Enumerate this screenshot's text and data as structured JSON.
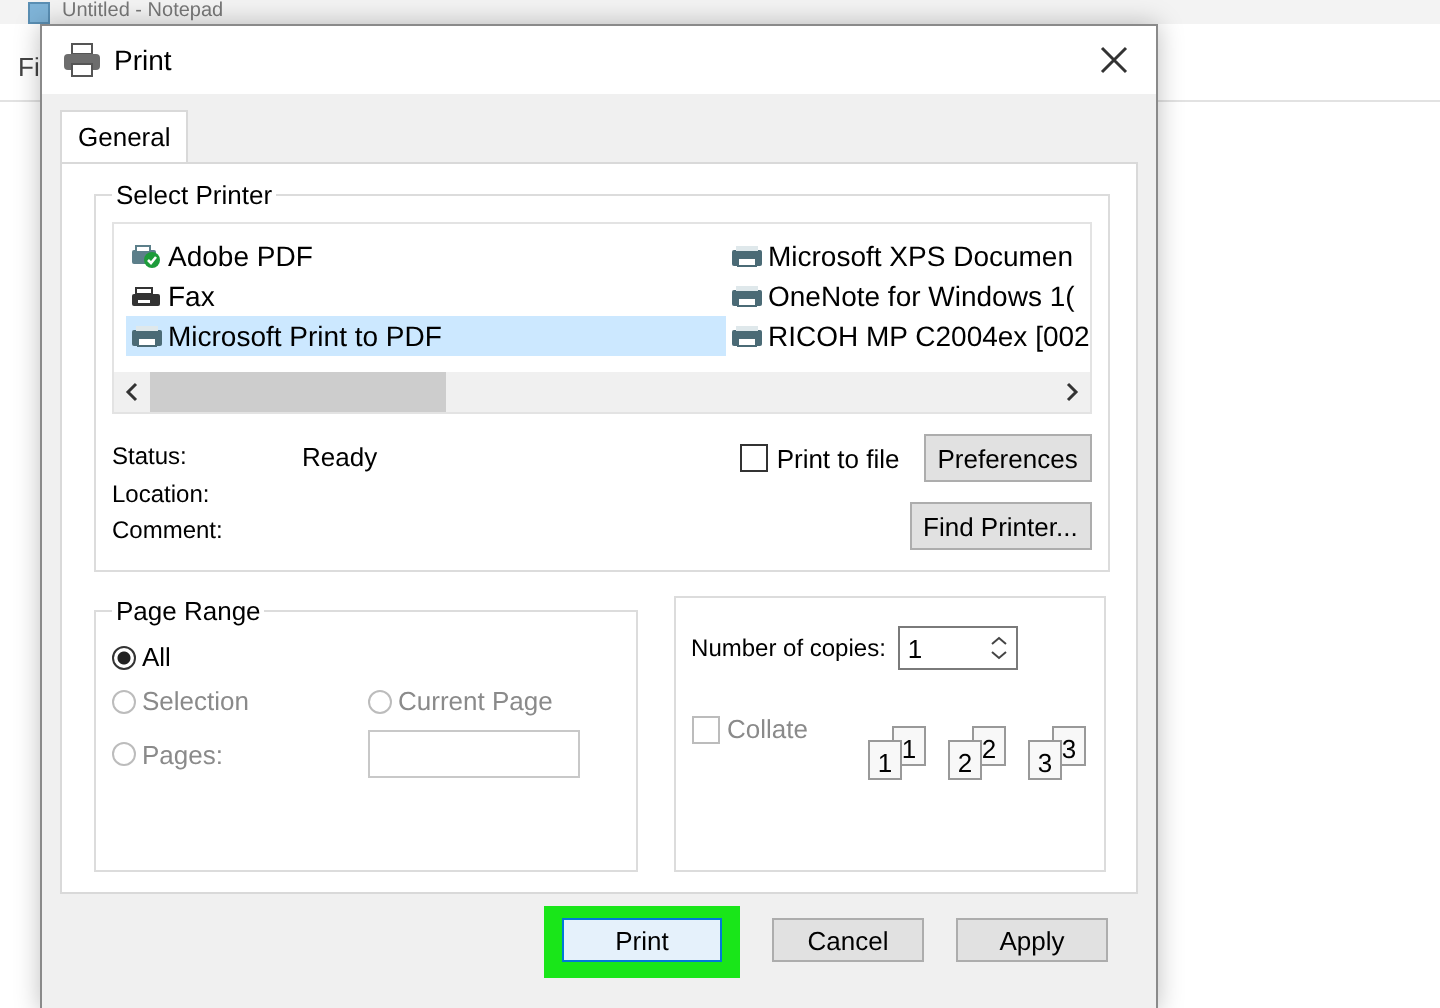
{
  "background_window": {
    "title": "Untitled - Notepad",
    "menu_item": "Fi"
  },
  "dialog": {
    "title": "Print"
  },
  "tabs": [
    {
      "label": "General",
      "selected": true
    }
  ],
  "select_printer": {
    "legend": "Select Printer",
    "printers": [
      {
        "name": "Adobe PDF",
        "kind": "default",
        "selected": false
      },
      {
        "name": "Fax",
        "kind": "fax",
        "selected": false
      },
      {
        "name": "Microsoft Print to PDF",
        "kind": "printer",
        "selected": true
      },
      {
        "name": "Microsoft XPS Documen",
        "kind": "printer",
        "selected": false
      },
      {
        "name": "OneNote for Windows 1(",
        "kind": "printer",
        "selected": false
      },
      {
        "name": "RICOH MP C2004ex [002",
        "kind": "printer",
        "selected": false
      }
    ],
    "info": [
      {
        "label": "Status:",
        "value": "Ready"
      },
      {
        "label": "Location:"
      },
      {
        "label": "Comment:"
      }
    ],
    "print_to_file": {
      "label": "Print to file",
      "checked": false
    },
    "buttons": [
      "Preferences",
      "Find Printer..."
    ]
  },
  "page_range": {
    "legend": "Page Range",
    "options": [
      {
        "label": "All",
        "selected": true,
        "disabled": false
      },
      {
        "label": "Selection",
        "selected": false,
        "disabled": true
      },
      {
        "label": "Current Page",
        "selected": false,
        "disabled": true
      },
      {
        "label": "Pages:",
        "selected": false,
        "disabled": true
      }
    ]
  },
  "copies": {
    "label": "Number of copies:",
    "value": "1",
    "collate": {
      "label": "Collate",
      "checked": false,
      "disabled": true
    },
    "collate_pages": [
      "1",
      "1",
      "2",
      "2",
      "3",
      "3"
    ]
  },
  "buttons": [
    {
      "label": "Print",
      "highlighted": true
    },
    {
      "label": "Cancel",
      "highlighted": false
    },
    {
      "label": "Apply",
      "highlighted": false
    }
  ]
}
